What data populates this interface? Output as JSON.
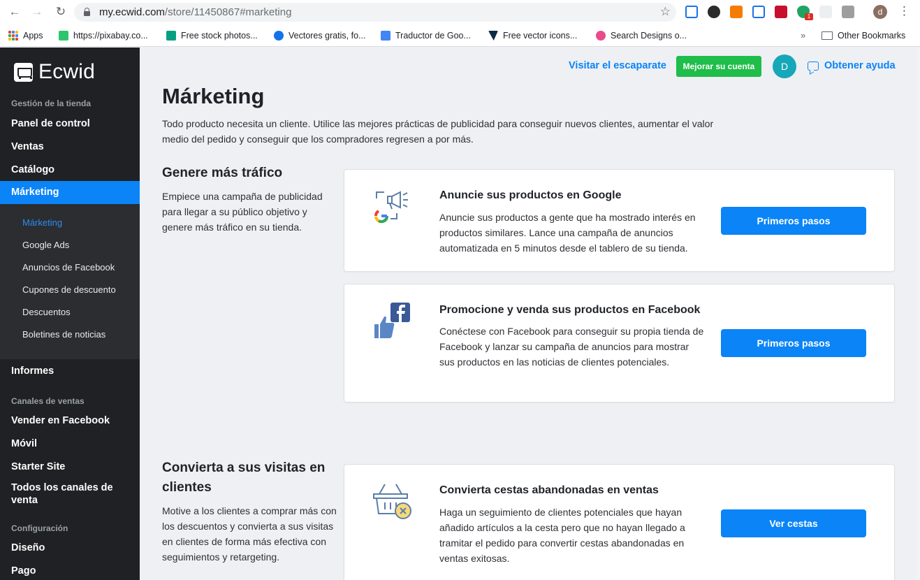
{
  "browser": {
    "url_host": "my.ecwid.com",
    "url_path": "/store/11450867#marketing",
    "profile_initial": "d",
    "extension_badge": "1",
    "bookmarks": [
      {
        "label": "Apps",
        "icon": "apps-grid-icon",
        "color": "#e8453c"
      },
      {
        "label": "https://pixabay.co...",
        "icon": "pixabay-icon",
        "color": "#2ec66d"
      },
      {
        "label": "Free stock photos...",
        "icon": "pexels-icon",
        "color": "#05a081"
      },
      {
        "label": "Vectores gratis, fo...",
        "icon": "freepik-icon",
        "color": "#1273eb"
      },
      {
        "label": "Traductor de Goo...",
        "icon": "google-translate-icon",
        "color": "#4285f4"
      },
      {
        "label": "Free vector icons...",
        "icon": "flaticon-icon",
        "color": "#0e2a47"
      },
      {
        "label": "Search Designs o...",
        "icon": "dribbble-icon",
        "color": "#ea4c89"
      }
    ],
    "more_bookmarks": "»",
    "other_bookmarks": "Other Bookmarks"
  },
  "sidebar": {
    "logo": "Ecwid",
    "sections": [
      {
        "title": "Gestión de la tienda"
      },
      {
        "title": "Canales de ventas"
      },
      {
        "title": "Configuración"
      }
    ],
    "items": [
      {
        "label": "Panel de control"
      },
      {
        "label": "Ventas"
      },
      {
        "label": "Catálogo"
      },
      {
        "label": "Márketing"
      },
      {
        "label": "Informes"
      },
      {
        "label": "Vender en Facebook"
      },
      {
        "label": "Móvil"
      },
      {
        "label": "Starter Site"
      },
      {
        "label": "Todos los canales de venta"
      },
      {
        "label": "Diseño"
      },
      {
        "label": "Pago"
      }
    ],
    "submenu": [
      {
        "label": "Márketing"
      },
      {
        "label": "Google Ads"
      },
      {
        "label": "Anuncios de Facebook"
      },
      {
        "label": "Cupones de descuento"
      },
      {
        "label": "Descuentos"
      },
      {
        "label": "Boletines de noticias"
      }
    ]
  },
  "topbar": {
    "visit_storefront": "Visitar el escaparate",
    "upgrade": "Mejorar su cuenta",
    "avatar_initial": "D",
    "help": "Obtener ayuda"
  },
  "page": {
    "title": "Márketing",
    "description": "Todo producto necesita un cliente. Utilice las mejores prácticas de publicidad para conseguir nuevos clientes, aumentar el valor medio del pedido y conseguir que los compradores regresen a por más."
  },
  "sections": [
    {
      "title": "Genere más tráfico",
      "description": "Empiece una campaña de publicidad para llegar a su público objetivo y genere más tráfico en su tienda.",
      "cards": [
        {
          "icon": "google-ads-icon",
          "title": "Anuncie sus productos en Google",
          "text": "Anuncie sus productos a gente que ha mostrado interés en productos similares. Lance una campaña de anuncios automatizada en 5 minutos desde el tablero de su tienda.",
          "button": "Primeros pasos"
        },
        {
          "icon": "facebook-like-icon",
          "title": "Promocione y venda sus productos en Facebook",
          "text": "Conéctese con Facebook para conseguir su propia tienda de Facebook y lanzar su campaña de anuncios para mostrar sus productos en las noticias de clientes potenciales.",
          "button": "Primeros pasos"
        }
      ]
    },
    {
      "title": "Convierta a sus visitas en clientes",
      "description": "Motive a los clientes a comprar más con los descuentos y convierta a sus visitas en clientes de forma más efectiva con seguimientos y retargeting.",
      "cards": [
        {
          "icon": "abandoned-basket-icon",
          "title": "Convierta cestas abandonadas en ventas",
          "text": "Haga un seguimiento de clientes potenciales que hayan añadido artículos a la cesta pero que no hayan llegado a tramitar el pedido para convertir cestas abandonadas en ventas exitosas.",
          "button": "Ver cestas"
        }
      ]
    }
  ],
  "colors": {
    "accent": "#0a84f7",
    "upgrade": "#1fbd49",
    "sidebar": "#1f2124",
    "avatar": "#16a7b8"
  }
}
